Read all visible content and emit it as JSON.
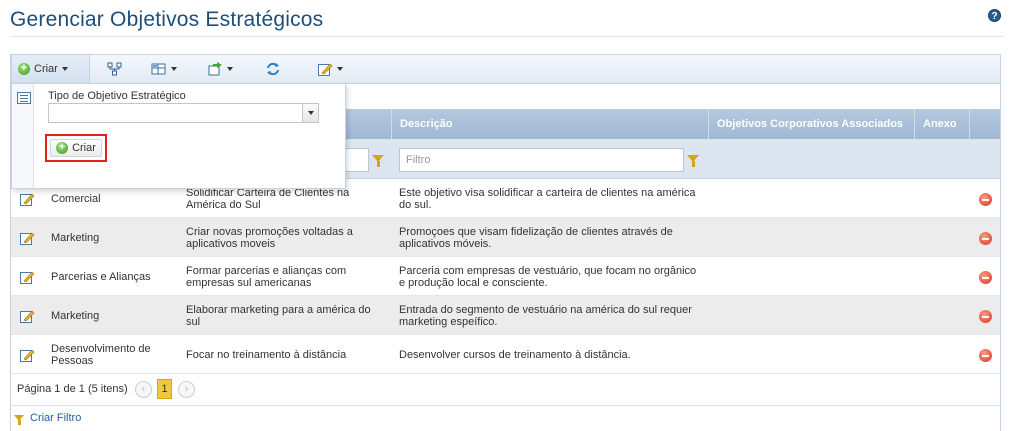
{
  "page": {
    "title": "Gerenciar Objetivos Estratégicos",
    "help_icon": "?"
  },
  "toolbar": {
    "create_label": "Criar"
  },
  "popup": {
    "field_label": "Tipo de Objetivo Estratégico",
    "select_value": "",
    "create_button_label": "Criar"
  },
  "table": {
    "columns": [
      "Descrição",
      "Objetivos Corporativos Associados",
      "Anexo"
    ],
    "filter_placeholder": "Filtro",
    "rows": [
      {
        "type": "Comercial",
        "name": "Solidificar Carteira de Clientes na América do Sul",
        "description": "Este objetivo visa solidificar a carteira de clientes na américa do sul."
      },
      {
        "type": "Marketing",
        "name": "Criar novas promoções voltadas a aplicativos moveis",
        "description": "Promoçoes que visam fidelização de clientes através de aplicativos móveis."
      },
      {
        "type": "Parcerias e Alianças",
        "name": "Formar parcerias e alianças com empresas sul americanas",
        "description": "Parceria com empresas de vestuário, que focam no orgânico e produção local e consciente."
      },
      {
        "type": "Marketing",
        "name": "Elaborar marketing para a américa do sul",
        "description": "Entrada do segmento de vestuário na américa do sul requer marketing espeífico."
      },
      {
        "type": "Desenvolvimento de Pessoas",
        "name": "Focar no treinamento à distância",
        "description": "Desenvolver cursos de treinamento à distância."
      }
    ]
  },
  "pager": {
    "summary": "Página 1 de 1 (5 itens)",
    "current_page": "1",
    "prev": "‹",
    "next": "›"
  },
  "footer": {
    "create_filter_label": "Criar Filtro"
  }
}
